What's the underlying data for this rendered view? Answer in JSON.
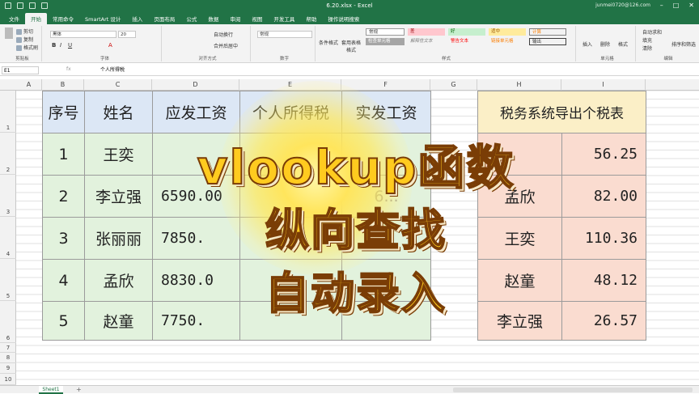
{
  "window": {
    "title": "6.20.xlsx - Excel",
    "account": "junmei0720@126.com"
  },
  "tabs": [
    "文件",
    "开始",
    "常用命令",
    "SmartArt 设计",
    "插入",
    "页面布局",
    "公式",
    "数据",
    "审阅",
    "视图",
    "开发工具",
    "帮助",
    "操作说明搜索"
  ],
  "ribbon": {
    "clipboard": {
      "cut": "剪切",
      "copy": "复制",
      "painter": "格式刷",
      "label": "剪贴板"
    },
    "font": {
      "name": "黑体",
      "size": "20",
      "label": "字体"
    },
    "align": {
      "wrap": "自动换行",
      "merge": "合并后居中",
      "label": "对齐方式"
    },
    "number": {
      "format": "常规",
      "label": "数字"
    },
    "styles": {
      "cond": "条件格式",
      "table": "套用表格格式",
      "label": "样式",
      "cells": [
        "常规",
        "差",
        "好",
        "适中",
        "计算",
        "检查单元格",
        "解释性文本",
        "警告文本",
        "链接单元格",
        "输出"
      ]
    },
    "cells": {
      "insert": "插入",
      "delete": "删除",
      "format": "格式",
      "label": "单元格"
    },
    "edit": {
      "sum": "自动求和",
      "fill": "填充",
      "clear": "清除",
      "sort": "排序和筛选",
      "label": "编辑"
    }
  },
  "formula_bar": {
    "name_box": "E1",
    "fx": "fx",
    "content": "个人所得税"
  },
  "columns": [
    "A",
    "B",
    "C",
    "D",
    "E",
    "F",
    "G",
    "H",
    "I"
  ],
  "rows": [
    "1",
    "2",
    "3",
    "4",
    "5",
    "6",
    "7",
    "8",
    "9",
    "10"
  ],
  "table": {
    "headers": [
      "序号",
      "姓名",
      "应发工资",
      "个人所得税",
      "实发工资"
    ],
    "rows": [
      [
        "1",
        "王奕",
        "",
        "",
        ""
      ],
      [
        "2",
        "李立强",
        "6590.00",
        "",
        "6..."
      ],
      [
        "3",
        "张丽丽",
        "7850.",
        "",
        ""
      ],
      [
        "4",
        "孟欣",
        "8830.0",
        "",
        ""
      ],
      [
        "5",
        "赵童",
        "7750.",
        "",
        ""
      ]
    ]
  },
  "tax_table": {
    "header": "税务系统导出个税表",
    "rows": [
      [
        "",
        "56.25"
      ],
      [
        "孟欣",
        "82.00"
      ],
      [
        "王奕",
        "110.36"
      ],
      [
        "赵童",
        "48.12"
      ],
      [
        "李立强",
        "26.57"
      ]
    ]
  },
  "overlay": {
    "line1": "vlookup函数",
    "line2": "纵向查找",
    "line3": "自动录入"
  },
  "sheet": {
    "tab": "Sheet1",
    "add": "+"
  },
  "colors": {
    "excel_green": "#217346",
    "header_blue": "#dce7f5",
    "row_green": "#e2f2dd",
    "tax_header_yellow": "#fbefc7",
    "tax_row_pink": "#fadcd0",
    "overlay_gold": "#ffcb1f"
  }
}
